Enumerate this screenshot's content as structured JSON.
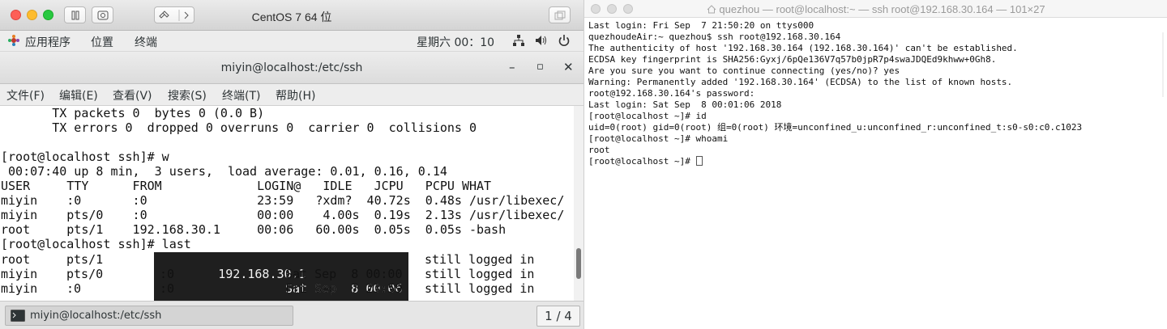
{
  "vm_window": {
    "title": "CentOS 7 64 位",
    "traffic_colors": [
      "#fd5f57",
      "#febc2e",
      "#28c840"
    ]
  },
  "gnome_bar": {
    "applications": "应用程序",
    "places": "位置",
    "terminal": "终端",
    "clock": "星期六 00：10"
  },
  "terminal_window": {
    "title": "miyin@localhost:/etc/ssh",
    "minimize": "–",
    "maximize": "▫",
    "close": "✕"
  },
  "menu": {
    "file": "文件(F)",
    "edit": "编辑(E)",
    "view": "查看(V)",
    "search": "搜索(S)",
    "terminal": "终端(T)",
    "help": "帮助(H)"
  },
  "term": {
    "l1": "       TX packets 0  bytes 0 (0.0 B)",
    "l2": "       TX errors 0  dropped 0 overruns 0  carrier 0  collisions 0",
    "l3": "",
    "l4": "[root@localhost ssh]# w",
    "l5": " 00:07:40 up 8 min,  3 users,  load average: 0.01, 0.16, 0.14",
    "l6": "USER     TTY      FROM             LOGIN@   IDLE   JCPU   PCPU WHAT",
    "l7": "miyin    :0       :0               23:59   ?xdm?  40.72s  0.48s /usr/libexec/",
    "l8": "miyin    pts/0    :0               00:00    4.00s  0.19s  2.13s /usr/libexec/",
    "l9": "root     pts/1    192.168.30.1     00:06   60.00s  0.05s  0.05s -bash",
    "l10": "[root@localhost ssh]# last",
    "last_rows": [
      {
        "user": "root",
        "tty": "pts/1",
        "host": "192.168.30.1",
        "date": "Sat Sep  8 00:06",
        "status": "still logged in"
      },
      {
        "user": "miyin",
        "tty": "pts/0",
        "host": ":0",
        "date": "Sat Sep  8 00:00",
        "status": "still logged in"
      },
      {
        "user": "miyin",
        "tty": ":0",
        "host": ":0",
        "date": "Fri Sep  7 23:59",
        "status": "still logged in"
      }
    ]
  },
  "taskbar": {
    "item_label": "miyin@localhost:/etc/ssh",
    "workspace": "1 / 4"
  },
  "mac_terminal": {
    "title": "quezhou — root@localhost:~ — ssh root@192.168.30.164 — 101×27",
    "lines": [
      "Last login: Fri Sep  7 21:50:20 on ttys000",
      "quezhoudeAir:~ quezhou$ ssh root@192.168.30.164",
      "The authenticity of host '192.168.30.164 (192.168.30.164)' can't be established.",
      "ECDSA key fingerprint is SHA256:Gyxj/6pQe136V7q57b0jpR7p4swaJDQEd9khww+0Gh8.",
      "Are you sure you want to continue connecting (yes/no)? yes",
      "Warning: Permanently added '192.168.30.164' (ECDSA) to the list of known hosts.",
      "root@192.168.30.164's password:",
      "Last login: Sat Sep  8 00:01:06 2018",
      "[root@localhost ~]# id",
      "uid=0(root) gid=0(root) 组=0(root) 环境=unconfined_u:unconfined_r:unconfined_t:s0-s0:c0.c1023",
      "[root@localhost ~]# whoami",
      "root"
    ],
    "prompt": "[root@localhost ~]# "
  }
}
